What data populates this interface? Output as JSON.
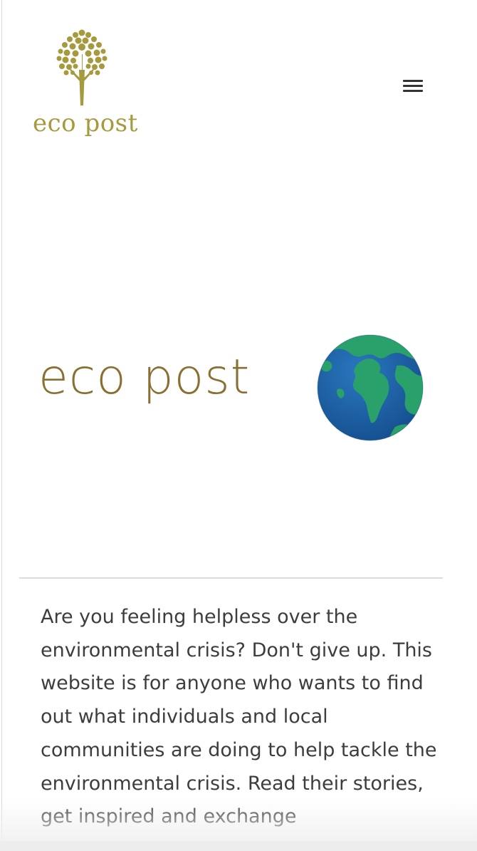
{
  "header": {
    "logo_text": "eco post",
    "menu_icon": "hamburger-menu-icon"
  },
  "hero": {
    "title": "eco post",
    "globe_icon": "earth-globe-icon"
  },
  "intro": {
    "text": "Are you feeling helpless over the environmental crisis? Don't give up. This website is for anyone who wants to find out what individuals and local communities are doing to help tackle the environmental crisis. Read their stories, get inspired and exchange"
  },
  "colors": {
    "logo_gold": "#a69a3e",
    "title_brown": "#8a6f32",
    "text": "#3d3d3d",
    "globe_ocean": "#1e5fa8",
    "globe_land": "#2aa06a"
  }
}
